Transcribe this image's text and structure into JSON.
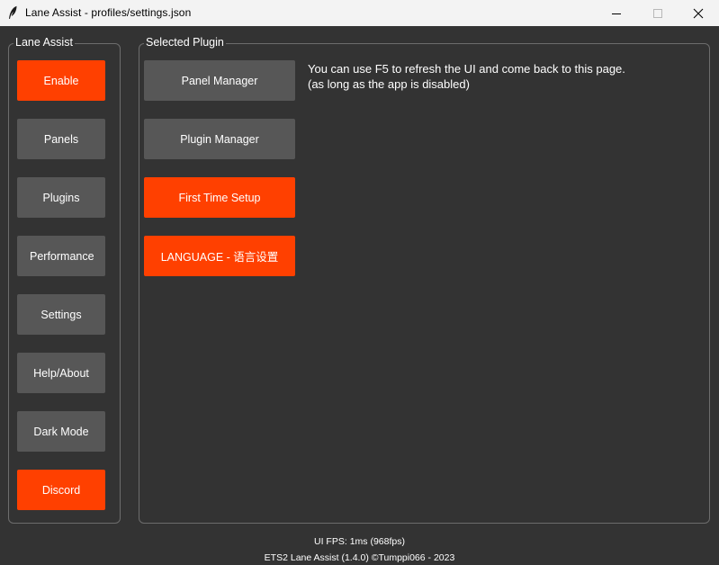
{
  "window": {
    "title": "Lane Assist - profiles/settings.json",
    "icon": "feather-icon",
    "controls": [
      "minimize-icon",
      "maximize-icon",
      "close-icon"
    ]
  },
  "sidebar": {
    "label": "Lane Assist",
    "items": [
      {
        "label": "Enable",
        "color": "#ff4000"
      },
      {
        "label": "Panels",
        "color": "#575757"
      },
      {
        "label": "Plugins",
        "color": "#575757"
      },
      {
        "label": "Performance",
        "color": "#575757"
      },
      {
        "label": "Settings",
        "color": "#575757"
      },
      {
        "label": "Help/About",
        "color": "#575757"
      },
      {
        "label": "Dark Mode",
        "color": "#575757"
      },
      {
        "label": "Discord",
        "color": "#ff4000"
      }
    ]
  },
  "main": {
    "label": "Selected Plugin",
    "buttons": [
      {
        "label": "Panel Manager",
        "color": "#575757"
      },
      {
        "label": "Plugin Manager",
        "color": "#575757"
      },
      {
        "label": "First Time Setup",
        "color": "#ff4000"
      },
      {
        "label": "LANGUAGE - 语言设置",
        "color": "#ff4000"
      }
    ],
    "info_line1": "You can use F5 to refresh the UI and come back to this page.",
    "info_line2": "(as long as the app is disabled)"
  },
  "footer": {
    "fps": "UI FPS: 1ms (968fps)",
    "version": "ETS2 Lane Assist (1.4.0)   ©Tumppi066 - 2023"
  },
  "colors": {
    "background": "#333333",
    "accent": "#ff4000",
    "button": "#575757",
    "titlebar": "#f3f3f3"
  }
}
